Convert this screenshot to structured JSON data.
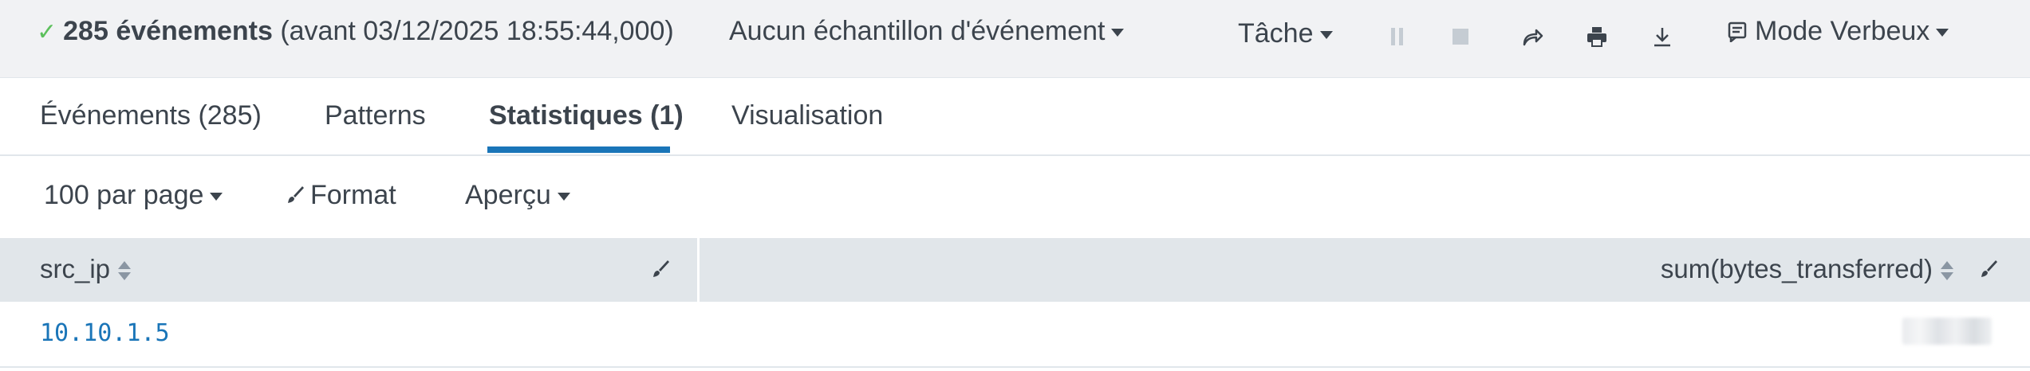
{
  "status": {
    "count_label": "285 événements",
    "time_label": "(avant 03/12/2025 18:55:44,000)"
  },
  "sampling": {
    "label": "Aucun échantillon d'événement"
  },
  "job": {
    "label": "Tâche"
  },
  "mode": {
    "label": "Mode Verbeux"
  },
  "tabs": [
    {
      "label": "Événements (285)"
    },
    {
      "label": "Patterns"
    },
    {
      "label": "Statistiques (1)"
    },
    {
      "label": "Visualisation"
    }
  ],
  "active_tab": "Statistiques (1)",
  "toolbar": {
    "per_page": "100 par page",
    "format": "Format",
    "preview": "Aperçu"
  },
  "table": {
    "columns": [
      "src_ip",
      "sum(bytes_transferred)"
    ],
    "rows": [
      {
        "src_ip": "10.10.1.5",
        "sum": ""
      }
    ]
  },
  "colors": {
    "accent": "#1a75b8",
    "success": "#5cc05c",
    "header_bg": "#e1e6ea",
    "topbar_bg": "#f1f2f4"
  }
}
